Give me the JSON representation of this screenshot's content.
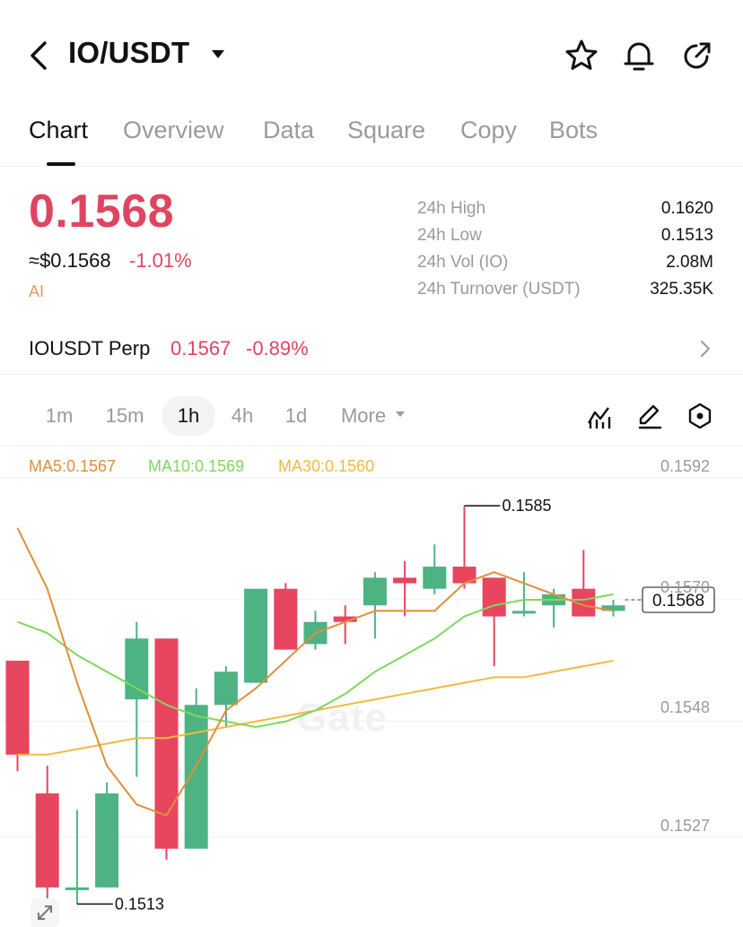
{
  "header": {
    "title": "IO/USDT"
  },
  "tabs": [
    {
      "label": "Chart",
      "active": true
    },
    {
      "label": "Overview",
      "active": false
    },
    {
      "label": "Data",
      "active": false
    },
    {
      "label": "Square",
      "active": false
    },
    {
      "label": "Copy",
      "active": false
    },
    {
      "label": "Bots",
      "active": false
    }
  ],
  "ticker": {
    "price": "0.1568",
    "usd_price": "≈$0.1568",
    "change": "-1.01%",
    "ai_label": "AI"
  },
  "stats": [
    {
      "label": "24h  High",
      "value": "0.1620"
    },
    {
      "label": "24h  Low",
      "value": "0.1513"
    },
    {
      "label": "24h  Vol (IO)",
      "value": "2.08M"
    },
    {
      "label": "24h  Turnover (USDT)",
      "value": "325.35K"
    }
  ],
  "perp": {
    "name": "IOUSDT Perp",
    "price": "0.1567",
    "change": "-0.89%"
  },
  "intervals": [
    {
      "label": "1m",
      "active": false
    },
    {
      "label": "15m",
      "active": false
    },
    {
      "label": "1h",
      "active": true
    },
    {
      "label": "4h",
      "active": false
    },
    {
      "label": "1d",
      "active": false
    },
    {
      "label": "More",
      "active": false
    }
  ],
  "ma": {
    "ma5": "MA5:0.1567",
    "ma10": "MA10:0.1569",
    "ma30": "MA30:0.1560"
  },
  "chart_data": {
    "type": "candlestick",
    "y_ticks": [
      "0.1592",
      "0.1570",
      "0.1548",
      "0.1527"
    ],
    "y_tick_values": [
      0.1592,
      0.157,
      0.1548,
      0.1527
    ],
    "current_price_label": "0.1568",
    "current_price": 0.1568,
    "high_marker": {
      "label": "0.1585",
      "value": 0.1585,
      "candle_index": 15
    },
    "low_marker": {
      "label": "0.1513",
      "value": 0.1513,
      "candle_index": 2
    },
    "watermark": "Gate",
    "colors": {
      "up": "#4db383",
      "down": "#e8455e",
      "ma5": "#e28e3a",
      "ma10": "#7fd85a",
      "ma30": "#efbb3f",
      "text": "#9a9a9a"
    },
    "candles": [
      {
        "o": 0.1557,
        "h": 0.1557,
        "l": 0.1537,
        "c": 0.154
      },
      {
        "o": 0.1533,
        "h": 0.1538,
        "l": 0.1514,
        "c": 0.1516
      },
      {
        "o": 0.1516,
        "h": 0.153,
        "l": 0.1513,
        "c": 0.1516
      },
      {
        "o": 0.1516,
        "h": 0.1535,
        "l": 0.1516,
        "c": 0.1533
      },
      {
        "o": 0.155,
        "h": 0.1564,
        "l": 0.1536,
        "c": 0.1561
      },
      {
        "o": 0.1561,
        "h": 0.1561,
        "l": 0.1521,
        "c": 0.1523
      },
      {
        "o": 0.1523,
        "h": 0.1552,
        "l": 0.1523,
        "c": 0.1549
      },
      {
        "o": 0.1549,
        "h": 0.1556,
        "l": 0.1545,
        "c": 0.1555
      },
      {
        "o": 0.1553,
        "h": 0.157,
        "l": 0.1553,
        "c": 0.157
      },
      {
        "o": 0.157,
        "h": 0.1571,
        "l": 0.1559,
        "c": 0.1559
      },
      {
        "o": 0.156,
        "h": 0.1566,
        "l": 0.1559,
        "c": 0.1564
      },
      {
        "o": 0.1565,
        "h": 0.1567,
        "l": 0.156,
        "c": 0.1564
      },
      {
        "o": 0.1567,
        "h": 0.1573,
        "l": 0.1561,
        "c": 0.1572
      },
      {
        "o": 0.1572,
        "h": 0.1575,
        "l": 0.1565,
        "c": 0.1571
      },
      {
        "o": 0.157,
        "h": 0.1578,
        "l": 0.1569,
        "c": 0.1574
      },
      {
        "o": 0.1574,
        "h": 0.1585,
        "l": 0.157,
        "c": 0.1571
      },
      {
        "o": 0.1572,
        "h": 0.1572,
        "l": 0.1556,
        "c": 0.1565
      },
      {
        "o": 0.1566,
        "h": 0.1573,
        "l": 0.1565,
        "c": 0.1566
      },
      {
        "o": 0.1567,
        "h": 0.157,
        "l": 0.1563,
        "c": 0.1569
      },
      {
        "o": 0.157,
        "h": 0.1577,
        "l": 0.1565,
        "c": 0.1565
      },
      {
        "o": 0.1566,
        "h": 0.1568,
        "l": 0.1565,
        "c": 0.1567
      }
    ],
    "ma5_line": [
      0.1581,
      0.157,
      0.1553,
      0.1538,
      0.1531,
      0.1529,
      0.1538,
      0.1548,
      0.1552,
      0.1557,
      0.1562,
      0.1564,
      0.1566,
      0.1566,
      0.1566,
      0.1571,
      0.1573,
      0.1571,
      0.1569,
      0.1567,
      0.1566
    ],
    "ma10_line": [
      0.1564,
      0.1562,
      0.1558,
      0.1555,
      0.1552,
      0.1549,
      0.1547,
      0.1546,
      0.1545,
      0.1546,
      0.1548,
      0.1551,
      0.1555,
      0.1558,
      0.1561,
      0.1565,
      0.1567,
      0.1568,
      0.1568,
      0.1568,
      0.1569
    ],
    "ma30_line": [
      0.154,
      0.154,
      0.1541,
      0.1542,
      0.1543,
      0.1543,
      0.1544,
      0.1545,
      0.1546,
      0.1547,
      0.1548,
      0.1549,
      0.155,
      0.1551,
      0.1552,
      0.1553,
      0.1554,
      0.1554,
      0.1555,
      0.1556,
      0.1557
    ]
  }
}
